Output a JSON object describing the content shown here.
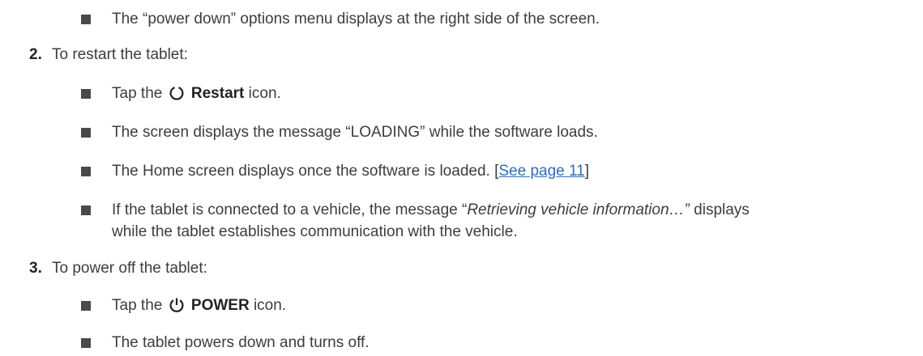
{
  "bullets_top": {
    "b0": "The “power down” options menu displays at the right side of the screen."
  },
  "steps": [
    {
      "number": "2.",
      "text": "To restart the tablet:",
      "items": {
        "tap_prefix": "Tap the",
        "tap_label": "Restart",
        "tap_suffix": "icon.",
        "icon": "restart-icon",
        "b1": "The screen displays the message “LOADING” while the software loads.",
        "b2_text": "The Home screen displays once the software is loaded. [",
        "b2_link": "See page 11",
        "b2_end": "]",
        "b3_prefix": "If the tablet is connected to a vehicle, the message “",
        "b3_italic": "Retrieving vehicle information…”",
        "b3_suffix": " displays",
        "b3_line2": "while the tablet establishes communication with the vehicle."
      }
    },
    {
      "number": "3.",
      "text": "To power off the tablet:",
      "items": {
        "tap_prefix": "Tap the",
        "tap_label": "POWER",
        "tap_suffix": "icon.",
        "icon": "power-icon",
        "b1": "The tablet powers down and turns off."
      }
    }
  ],
  "colors": {
    "text": "#3d3d3d",
    "bullet": "#4a4a4a",
    "link": "#2f6db5"
  }
}
